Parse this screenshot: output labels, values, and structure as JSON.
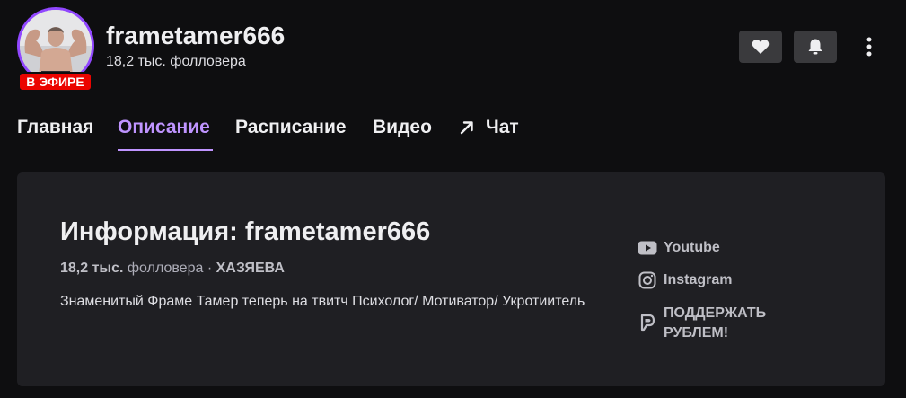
{
  "channel": {
    "name": "frametamer666",
    "followers": "18,2 тыс. фолловера",
    "live_badge": "В ЭФИРЕ"
  },
  "actions": {
    "follow_icon": "heart-icon",
    "notify_icon": "bell-icon",
    "more_icon": "vertical-dots-icon"
  },
  "tabs": [
    {
      "label": "Главная"
    },
    {
      "label": "Описание",
      "active": true
    },
    {
      "label": "Расписание"
    },
    {
      "label": "Видео"
    },
    {
      "label": "Чат",
      "icon": "external-arrow-icon"
    }
  ],
  "about": {
    "title": "Информация: frametamer666",
    "followers_count": "18,2 тыс.",
    "followers_word": "фолловера",
    "separator": "·",
    "team": "ХАЗЯЕВА",
    "description": "Знаменитый Фраме Тамер теперь на твитч Психолог/ Мотиватор/ Укротиитель"
  },
  "social_links": [
    {
      "label": "Youtube",
      "icon": "youtube-icon"
    },
    {
      "label": "Instagram",
      "icon": "instagram-icon"
    },
    {
      "label": "ПОДДЕРЖАТЬ РУБЛЕМ!",
      "icon": "donate-icon"
    }
  ],
  "colors": {
    "background": "#0e0e10",
    "panel": "#1f1f23",
    "accent": "#bf94ff",
    "live": "#eb0400",
    "button": "#3a3a3d"
  }
}
